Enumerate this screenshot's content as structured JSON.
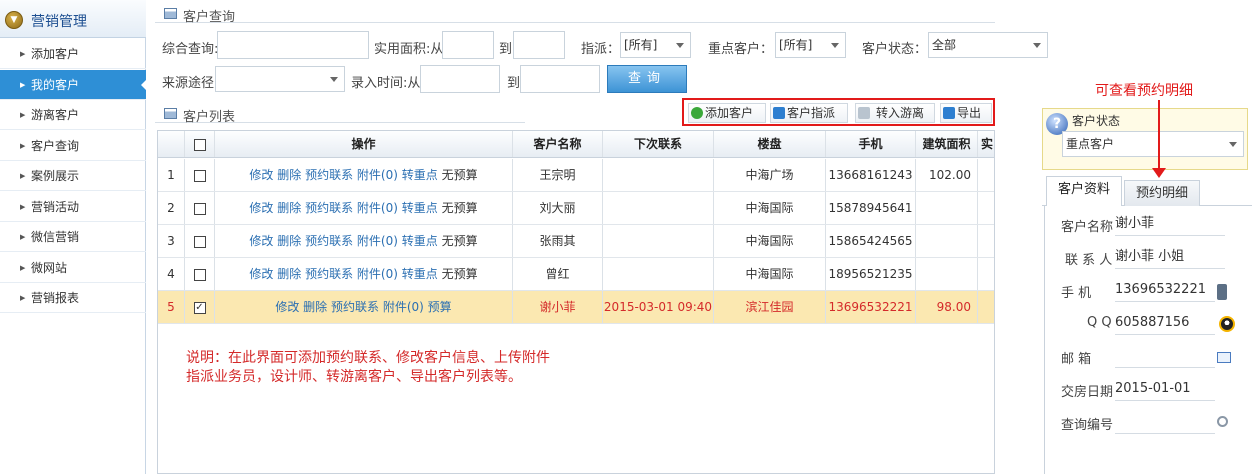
{
  "sidebar": {
    "title": "营销管理",
    "items": [
      {
        "label": "添加客户",
        "active": false
      },
      {
        "label": "我的客户",
        "active": true
      },
      {
        "label": "游离客户",
        "active": false
      },
      {
        "label": "客户查询",
        "active": false
      },
      {
        "label": "案例展示",
        "active": false
      },
      {
        "label": "营销活动",
        "active": false
      },
      {
        "label": "微信营销",
        "active": false
      },
      {
        "label": "微网站",
        "active": false
      },
      {
        "label": "营销报表",
        "active": false
      }
    ]
  },
  "query": {
    "section_title": "客户查询",
    "comprehensive_label": "综合查询:",
    "comprehensive_value": "",
    "area_label": "实用面积:从",
    "area_from": "",
    "to_label": "到",
    "area_to": "",
    "assign_label": "指派：",
    "assign_value": "[所有]",
    "key_label": "重点客户：",
    "key_value": "[所有]",
    "status_label": "客户状态：",
    "status_value": "全部",
    "source_label": "来源途径",
    "source_value": "",
    "entry_label": "录入时间:从",
    "entry_from": "",
    "entry_to_label": "到",
    "entry_to": "",
    "query_button": "查询"
  },
  "list": {
    "section_title": "客户列表",
    "toolbar": {
      "add": "添加客户",
      "assign": "客户指派",
      "to_free": "转入游离",
      "export": "导出"
    },
    "columns": [
      "操作",
      "客户名称",
      "下次联系",
      "楼盘",
      "手机",
      "建筑面积",
      "实"
    ],
    "rows": [
      {
        "no": "1",
        "checked": false,
        "ops": [
          "修改",
          "删除",
          "预约联系",
          "附件(0)",
          "转重点"
        ],
        "ops_tail": "无预算",
        "name": "王宗明",
        "next": "",
        "building": "中海广场",
        "phone": "13668161243",
        "area": "102.00"
      },
      {
        "no": "2",
        "checked": false,
        "ops": [
          "修改",
          "删除",
          "预约联系",
          "附件(0)",
          "转重点"
        ],
        "ops_tail": "无预算",
        "name": "刘大丽",
        "next": "",
        "building": "中海国际",
        "phone": "15878945641",
        "area": ""
      },
      {
        "no": "3",
        "checked": false,
        "ops": [
          "修改",
          "删除",
          "预约联系",
          "附件(0)",
          "转重点"
        ],
        "ops_tail": "无预算",
        "name": "张雨其",
        "next": "",
        "building": "中海国际",
        "phone": "15865424565",
        "area": ""
      },
      {
        "no": "4",
        "checked": false,
        "ops": [
          "修改",
          "删除",
          "预约联系",
          "附件(0)",
          "转重点"
        ],
        "ops_tail": "无预算",
        "name": "曾红",
        "next": "",
        "building": "中海国际",
        "phone": "18956521235",
        "area": ""
      },
      {
        "no": "5",
        "checked": true,
        "ops": [
          "修改",
          "删除",
          "预约联系",
          "附件(0)",
          "预算"
        ],
        "ops_tail": "",
        "name": "谢小菲",
        "next": "2015-03-01 09:40",
        "building": "滨江佳园",
        "phone": "13696532221",
        "area": "98.00"
      }
    ],
    "check_mark": "✓"
  },
  "note": {
    "line1": "说明：在此界面可添加预约联系、修改客户信息、上传附件",
    "line2": "指派业务员，设计师、转游离客户、导出客户列表等。"
  },
  "right": {
    "annotation": "可查看预约明细",
    "status_label": "客户状态",
    "status_value": "重点客户",
    "tabs": [
      "客户资料",
      "预约明细"
    ],
    "fields": [
      {
        "label": "客户名称",
        "value": "谢小菲"
      },
      {
        "label": "联 系 人",
        "value": "谢小菲  小姐"
      },
      {
        "label": "手      机",
        "value": "13696532221"
      },
      {
        "label": "Q Q",
        "value": "605887156"
      },
      {
        "label": "邮      箱",
        "value": ""
      },
      {
        "label": "交房日期",
        "value": "2015-01-01"
      },
      {
        "label": "查询编号",
        "value": ""
      }
    ]
  },
  "colors": {
    "accent": "#2e8fd6",
    "highlight": "#fbe8b1",
    "alert": "#e21a1a"
  }
}
